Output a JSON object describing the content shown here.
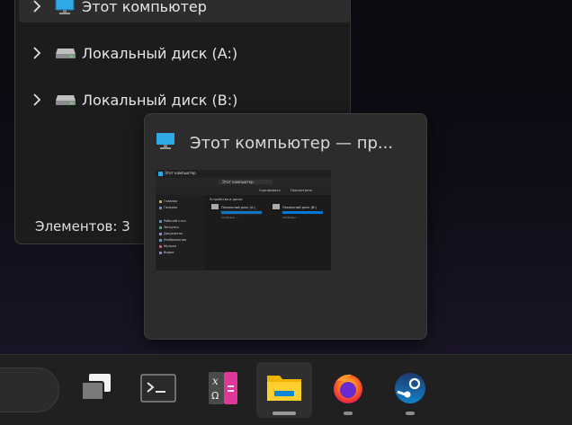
{
  "explorer": {
    "tree": [
      {
        "label": "Этот компьютер",
        "icon": "monitor-icon",
        "selected": true
      },
      {
        "label": "Локальный диск (A:)",
        "icon": "drive-icon"
      },
      {
        "label": "Локальный диск (B:)",
        "icon": "drive-icon"
      }
    ],
    "status": "Элементов: 3"
  },
  "preview": {
    "title": "Этот компьютер — пр...",
    "thumb": {
      "window_title": "Этот компьютер",
      "address": "Этот компьютер",
      "toolbar_labels": [
        "Сортировать",
        "Просмотреть"
      ],
      "sidebar": [
        "Главная",
        "Галерея",
        "Рабочий стол",
        "Загрузки",
        "Документы",
        "Изображения",
        "Музыка",
        "Видео"
      ],
      "section": "Устройства и диски",
      "drives": [
        {
          "name": "Локальный диск (A:)",
          "free": "Свободно ..."
        },
        {
          "name": "Локальный диск (B:)",
          "free": "Свободно ..."
        }
      ]
    }
  },
  "taskbar": {
    "apps": [
      "task-view-icon",
      "terminal-icon",
      "calculator-icon",
      "file-explorer-icon",
      "firefox-icon",
      "steam-icon"
    ],
    "active": "file-explorer-icon",
    "accent": "#0078d4"
  }
}
